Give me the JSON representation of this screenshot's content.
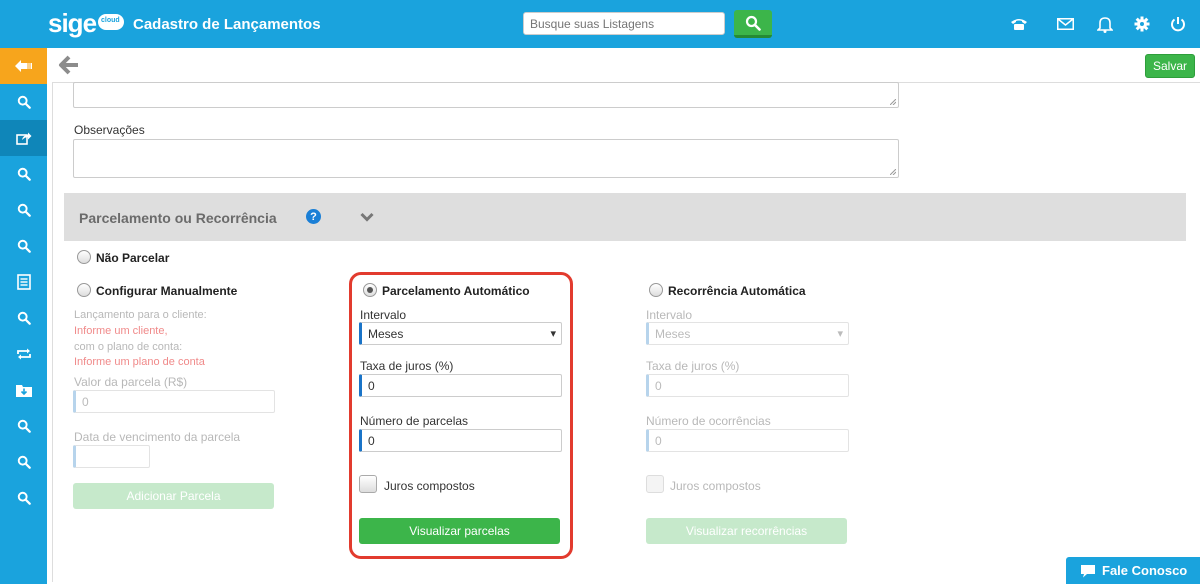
{
  "header": {
    "logo_text": "sige",
    "logo_badge": "cloud",
    "title": "Cadastro de Lançamentos",
    "search_placeholder": "Busque suas Listagens",
    "icons": [
      "phone-icon",
      "mail-icon",
      "bell-icon",
      "gear-icon",
      "power-icon"
    ]
  },
  "sidebar": {
    "items": [
      "back-icon",
      "search-icon",
      "share-icon",
      "search-icon",
      "search-icon",
      "search-icon",
      "report-icon",
      "search-icon",
      "repeat-icon",
      "download-icon",
      "search-icon",
      "search-icon",
      "search-icon"
    ]
  },
  "toolbar": {
    "save_label": "Salvar"
  },
  "form": {
    "observacoes_label": "Observações",
    "section_title": "Parcelamento ou Recorrência",
    "help_glyph": "?",
    "nao_parcelar": "Não Parcelar",
    "manual": {
      "title": "Configurar Manualmente",
      "line1": "Lançamento para o cliente:",
      "line2": "Informe um cliente,",
      "line3": "com o plano de conta:",
      "line4": "Informe um plano de conta",
      "valor_label": "Valor da parcela (R$)",
      "valor_value": "0",
      "vencimento_label": "Data de vencimento da parcela",
      "add_button": "Adicionar Parcela"
    },
    "auto": {
      "title": "Parcelamento Automático",
      "intervalo_label": "Intervalo",
      "intervalo_value": "Meses",
      "taxa_label": "Taxa de juros (%)",
      "taxa_value": "0",
      "parcelas_label": "Número de parcelas",
      "parcelas_value": "0",
      "juros_label": "Juros compostos",
      "view_button": "Visualizar parcelas"
    },
    "recorrencia": {
      "title": "Recorrência Automática",
      "intervalo_label": "Intervalo",
      "intervalo_value": "Meses",
      "taxa_label": "Taxa de juros (%)",
      "taxa_value": "0",
      "ocorrencias_label": "Número de ocorrências",
      "ocorrencias_value": "0",
      "juros_label": "Juros compostos",
      "view_button": "Visualizar recorrências"
    }
  },
  "chat": {
    "label": "Fale Conosco"
  },
  "colors": {
    "primary": "#1aa3dd",
    "green": "#3cb54a",
    "orange": "#f7a51c",
    "highlight": "#e23b2e"
  }
}
